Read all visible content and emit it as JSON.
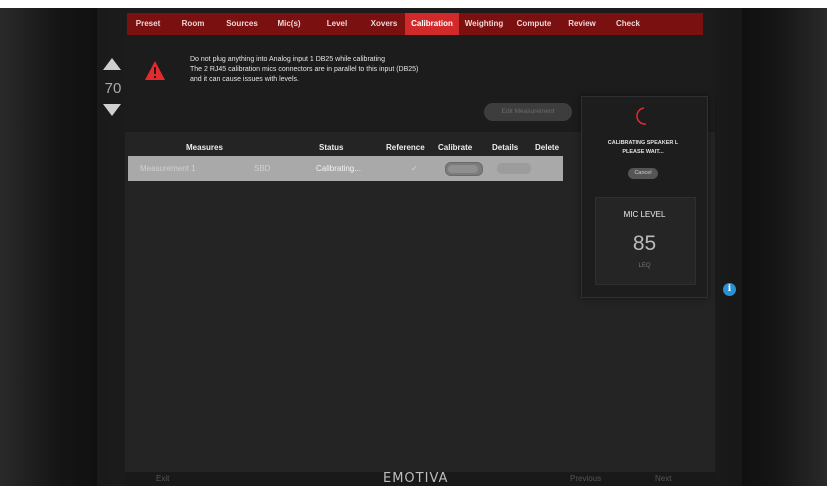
{
  "nav": {
    "items": [
      "Preset",
      "Room",
      "Sources",
      "Mic(s)",
      "Level",
      "Xovers",
      "Calibration",
      "Weighting",
      "Compute",
      "Review",
      "Check"
    ],
    "active_index": 6
  },
  "volume": {
    "value": "70"
  },
  "warning": {
    "line1": "Do not plug anything into Analog input 1 DB25 while calibrating",
    "line2": "The 2 RJ45 calibration mics connectors are in parallel to this input (DB25)",
    "line3": "and it can cause issues with levels."
  },
  "edit_button": "Edit Measurement",
  "table": {
    "headers": {
      "measures": "Measures",
      "status": "Status",
      "reference": "Reference",
      "calibrate": "Calibrate",
      "details": "Details",
      "delete": "Delete"
    },
    "rows": [
      {
        "name": "Measurement 1",
        "code": "SBD",
        "status": "Calibrating...",
        "reference": "✓"
      }
    ]
  },
  "calibration_card": {
    "line1": "CALIBRATING SPEAKER L",
    "line2": "PLEASE WAIT...",
    "cancel": "Cancel",
    "mic_level_label": "MIC LEVEL",
    "mic_level_value": "85",
    "mic_level_unit": "LEQ"
  },
  "footer": {
    "left": "Exit",
    "logo": "EMOTIVA",
    "previous": "Previous",
    "next": "Next"
  },
  "colors": {
    "nav_bg": "#7a1010",
    "nav_active": "#d22a2a",
    "warning": "#e32b2b",
    "info": "#2b8fd6"
  }
}
